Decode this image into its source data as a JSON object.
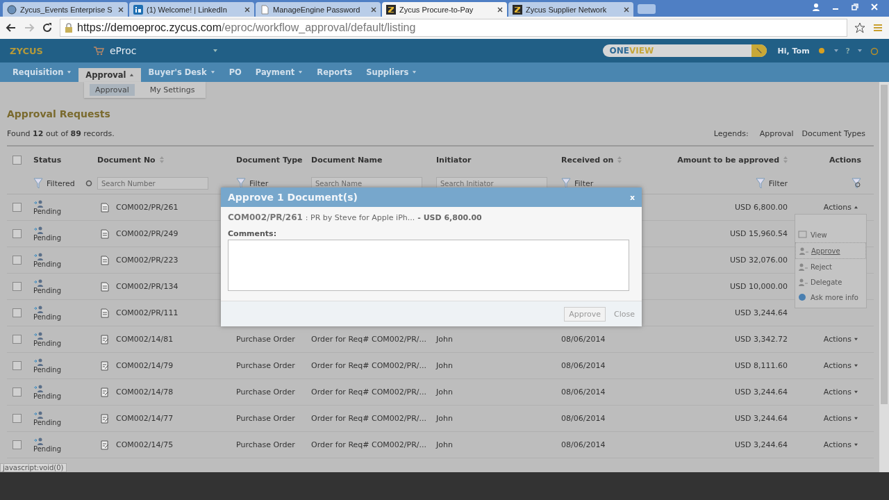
{
  "browser": {
    "tabs": [
      {
        "title": "Zycus_Events Enterprise S",
        "kind": "globe",
        "selected": false
      },
      {
        "title": "(1) Welcome! | LinkedIn",
        "kind": "linkedin",
        "selected": false
      },
      {
        "title": "ManageEngine Password",
        "kind": "document",
        "selected": false
      },
      {
        "title": "Zycus Procure-to-Pay",
        "kind": "zycus",
        "selected": true
      },
      {
        "title": "Zycus Supplier Network",
        "kind": "zycus",
        "selected": false
      }
    ],
    "url_host": "https://demoeproc.zycus.com",
    "url_path": "/eproc/workflow_approval/default/listing"
  },
  "app": {
    "logo": "ZYCUS",
    "module": "eProc",
    "search_brand_a": "ONE",
    "search_brand_b": "VIEW",
    "greeting": "Hi, Tom",
    "help": "?"
  },
  "nav": {
    "items": [
      {
        "label": "Requisition",
        "caret": true,
        "selected": false
      },
      {
        "label": "Approval",
        "caret": true,
        "selected": true
      },
      {
        "label": "Buyer's Desk",
        "caret": true,
        "selected": false
      },
      {
        "label": "PO",
        "caret": false,
        "selected": false
      },
      {
        "label": "Payment",
        "caret": true,
        "selected": false
      },
      {
        "label": "Reports",
        "caret": false,
        "selected": false
      },
      {
        "label": "Suppliers",
        "caret": true,
        "selected": false
      }
    ],
    "submenu": [
      {
        "label": "Approval",
        "selected": true
      },
      {
        "label": "My Settings",
        "selected": false
      }
    ]
  },
  "page": {
    "title": "Approval Requests",
    "summary": "Found **12** out of **89** records.",
    "legends_label": "Legends:",
    "legends": [
      "Approval",
      "Document Types"
    ]
  },
  "table": {
    "select_all_checked": false,
    "columns": [
      {
        "label": "Status",
        "sortable": false
      },
      {
        "label": "Document No",
        "sortable": true
      },
      {
        "label": "Document Type",
        "sortable": false
      },
      {
        "label": "Document Name",
        "sortable": false
      },
      {
        "label": "Initiator",
        "sortable": false
      },
      {
        "label": "Received on",
        "sortable": true
      },
      {
        "label": "Amount to be approved",
        "sortable": true
      },
      {
        "label": "Actions",
        "sortable": false
      }
    ],
    "filters": {
      "status": "Filtered",
      "doc_no": {
        "placeholder": "Search Number"
      },
      "doc_type": "Filter",
      "doc_name": {
        "placeholder": "Search Name"
      },
      "initiator": {
        "placeholder": "Search Initiator"
      },
      "received": "Filter",
      "amount": "Filter"
    },
    "rows": [
      {
        "checked": false,
        "status": "Pending",
        "kind": "requisition",
        "doc_no": "COM002/PR/261",
        "amount": "USD 6,800.00",
        "actions": "Actions"
      },
      {
        "checked": false,
        "status": "Pending",
        "kind": "requisition",
        "doc_no": "COM002/PR/249",
        "amount": "USD 15,960.54"
      },
      {
        "checked": false,
        "status": "Pending",
        "kind": "requisition",
        "doc_no": "COM002/PR/223",
        "amount": "USD 32,076.00"
      },
      {
        "checked": false,
        "status": "Pending",
        "kind": "requisition",
        "doc_no": "COM002/PR/134",
        "amount": "USD 10,000.00"
      },
      {
        "checked": false,
        "status": "Pending",
        "kind": "requisition",
        "doc_no": "COM002/PR/111",
        "amount": "USD 3,244.64"
      },
      {
        "checked": false,
        "status": "Pending",
        "kind": "order",
        "doc_no": "COM002/14/81",
        "doc_type": "Purchase Order",
        "doc_name": "Order for Req# COM002/PR/...",
        "initiator": "John",
        "received": "08/06/2014",
        "amount": "USD 3,342.72",
        "actions": "Actions"
      },
      {
        "checked": false,
        "status": "Pending",
        "kind": "order",
        "doc_no": "COM002/14/79",
        "doc_type": "Purchase Order",
        "doc_name": "Order for Req# COM002/PR/...",
        "initiator": "John",
        "received": "08/06/2014",
        "amount": "USD 8,111.60",
        "actions": "Actions"
      },
      {
        "checked": false,
        "status": "Pending",
        "kind": "order",
        "doc_no": "COM002/14/78",
        "doc_type": "Purchase Order",
        "doc_name": "Order for Req# COM002/PR/...",
        "initiator": "John",
        "received": "08/06/2014",
        "amount": "USD 3,244.64",
        "actions": "Actions"
      },
      {
        "checked": false,
        "status": "Pending",
        "kind": "order",
        "doc_no": "COM002/14/77",
        "doc_type": "Purchase Order",
        "doc_name": "Order for Req# COM002/PR/...",
        "initiator": "John",
        "received": "08/06/2014",
        "amount": "USD 3,244.64",
        "actions": "Actions"
      },
      {
        "checked": false,
        "status": "Pending",
        "kind": "order",
        "doc_no": "COM002/14/75",
        "doc_type": "Purchase Order",
        "doc_name": "Order for Req# COM002/PR/...",
        "initiator": "John",
        "received": "08/06/2014",
        "amount": "USD 3,244.64",
        "actions": "Actions"
      }
    ]
  },
  "actions_menu": {
    "items": [
      {
        "label": "View",
        "kind": "view",
        "selected": false
      },
      {
        "label": "Approve",
        "kind": "person",
        "selected": true
      },
      {
        "label": "Reject",
        "kind": "person",
        "selected": false
      },
      {
        "label": "Delegate",
        "kind": "person",
        "selected": false
      },
      {
        "label": "Ask more info",
        "kind": "globe",
        "selected": false
      }
    ]
  },
  "dialog": {
    "title": "Approve 1 Document(s)",
    "close": "x",
    "doc_no": "COM002/PR/261",
    "doc_desc": ": PR by Steve for Apple iPh...",
    "doc_amount": "- USD 6,800.00",
    "comments_label": "Comments:",
    "buttons": [
      {
        "label": "Approve",
        "kind": "primary"
      },
      {
        "label": "Close",
        "kind": "link"
      }
    ]
  },
  "status_text": "javascript:void(0)"
}
